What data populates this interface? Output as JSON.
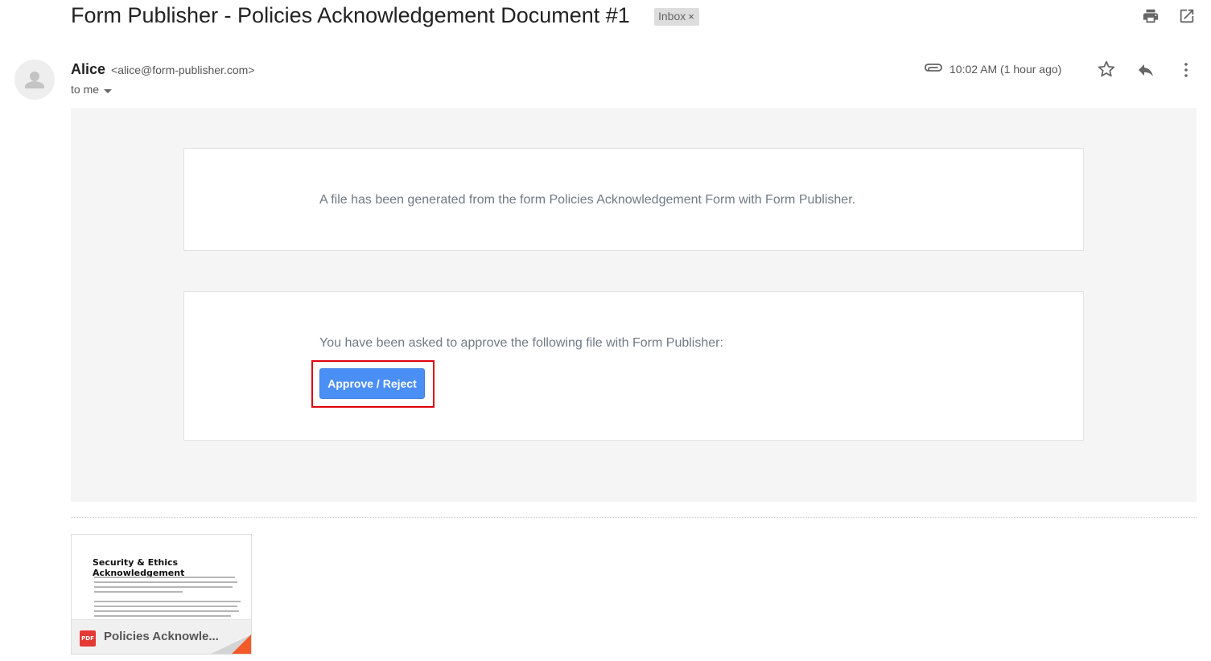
{
  "email": {
    "subject": "Form Publisher - Policies Acknowledgement Document #1",
    "label_tag": "Inbox",
    "label_remove": "×",
    "sender_name": "Alice",
    "sender_email": "<alice@form-publisher.com>",
    "recipient": "to me",
    "timestamp": "10:02 AM (1 hour ago)"
  },
  "body": {
    "card1_text": "A file has been generated from the form Policies Acknowledgement Form with Form Publisher.",
    "card2_text": "You have been asked to approve the following file with Form Publisher:",
    "approve_button": "Approve / Reject",
    "button_color": "#4a8ff5",
    "highlight_color": "#e0000f"
  },
  "attachment": {
    "preview_title": "Security & Ethics Acknowledgement",
    "file_type": "PDF",
    "file_name": "Policies Acknowle...",
    "icon": "pdf-icon"
  },
  "icons": {
    "print": "print-icon",
    "open_new_window": "open-in-new-window-icon",
    "attachment": "paperclip-icon",
    "star": "star-icon",
    "reply": "reply-icon",
    "more": "more-vertical-icon",
    "avatar": "default-avatar-icon",
    "dropdown": "caret-down-icon"
  }
}
